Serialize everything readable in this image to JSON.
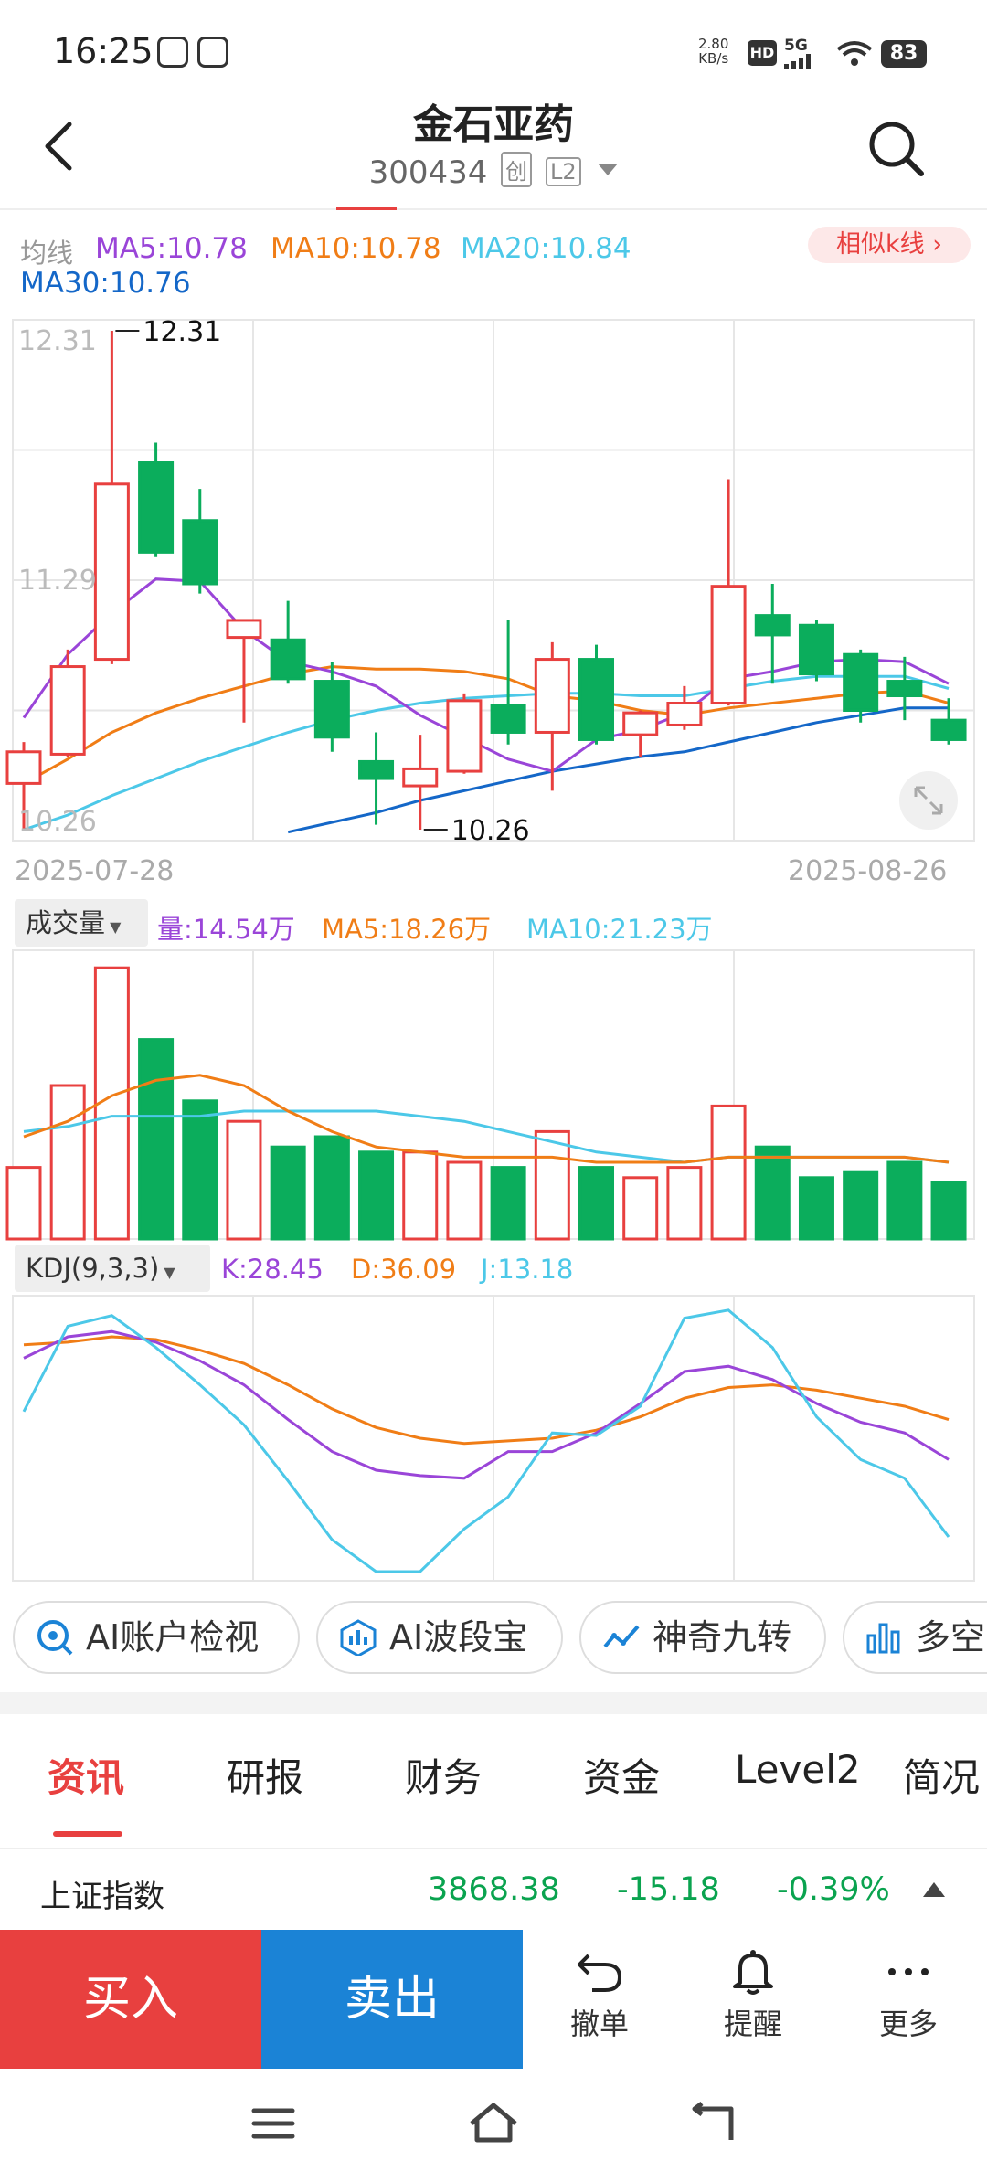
{
  "status_bar": {
    "time": "16:25",
    "net_speed_value": "2.80",
    "net_speed_unit": "KB/s",
    "hd": "HD",
    "network": "5G",
    "battery": "83"
  },
  "header": {
    "stock_name": "金石亚药",
    "stock_code": "300434",
    "tag_chuang": "创",
    "tag_level": "L2"
  },
  "ma_legend": {
    "label": "均线",
    "ma5": "MA5:10.78",
    "ma10": "MA10:10.78",
    "ma20": "MA20:10.84",
    "ma30": "MA30:10.76",
    "similar_button": "相似k线 ›"
  },
  "colors": {
    "up": "#e8403f",
    "down": "#0bad5c",
    "ma5": "#9a45d8",
    "ma10": "#f07d16",
    "ma20": "#4cc8e8",
    "ma30": "#1467c8",
    "index_green": "#0aa34f"
  },
  "price_axis": {
    "top_label": "12.31",
    "mid_label": "11.29",
    "bottom_label": "10.26",
    "high_marker": "12.31",
    "low_marker": "10.26",
    "start_date": "2025-07-28",
    "end_date": "2025-08-26"
  },
  "chart_data": {
    "type": "candlestick",
    "dates_shown": [
      "2025-07-28",
      "2025-08-26"
    ],
    "ylim": [
      10.26,
      12.31
    ],
    "candles": [
      {
        "open": 10.45,
        "close": 10.58,
        "high": 10.62,
        "low": 10.26
      },
      {
        "open": 10.57,
        "close": 10.93,
        "high": 11.0,
        "low": 10.56
      },
      {
        "open": 10.96,
        "close": 11.68,
        "high": 12.31,
        "low": 10.94
      },
      {
        "open": 11.77,
        "close": 11.4,
        "high": 11.85,
        "low": 11.38
      },
      {
        "open": 11.53,
        "close": 11.27,
        "high": 11.66,
        "low": 11.23
      },
      {
        "open": 11.05,
        "close": 11.12,
        "high": 11.12,
        "low": 10.7
      },
      {
        "open": 11.04,
        "close": 10.88,
        "high": 11.2,
        "low": 10.86
      },
      {
        "open": 10.87,
        "close": 10.64,
        "high": 10.95,
        "low": 10.58
      },
      {
        "open": 10.54,
        "close": 10.47,
        "high": 10.66,
        "low": 10.28
      },
      {
        "open": 10.44,
        "close": 10.51,
        "high": 10.65,
        "low": 10.26
      },
      {
        "open": 10.5,
        "close": 10.79,
        "high": 10.82,
        "low": 10.49
      },
      {
        "open": 10.77,
        "close": 10.66,
        "high": 11.12,
        "low": 10.61
      },
      {
        "open": 10.66,
        "close": 10.96,
        "high": 11.03,
        "low": 10.42
      },
      {
        "open": 10.96,
        "close": 10.63,
        "high": 11.02,
        "low": 10.61
      },
      {
        "open": 10.65,
        "close": 10.74,
        "high": 10.75,
        "low": 10.56
      },
      {
        "open": 10.69,
        "close": 10.78,
        "high": 10.85,
        "low": 10.67
      },
      {
        "open": 10.78,
        "close": 11.26,
        "high": 11.7,
        "low": 10.77
      },
      {
        "open": 11.14,
        "close": 11.06,
        "high": 11.27,
        "low": 10.86
      },
      {
        "open": 11.1,
        "close": 10.9,
        "high": 11.12,
        "low": 10.87
      },
      {
        "open": 10.98,
        "close": 10.75,
        "high": 11.0,
        "low": 10.7
      },
      {
        "open": 10.87,
        "close": 10.81,
        "high": 10.97,
        "low": 10.71
      },
      {
        "open": 10.71,
        "close": 10.63,
        "high": 10.8,
        "low": 10.61
      }
    ],
    "ma5": [
      10.72,
      10.98,
      11.15,
      11.29,
      11.28,
      11.08,
      10.95,
      10.91,
      10.85,
      10.73,
      10.64,
      10.55,
      10.5,
      10.63,
      10.67,
      10.74,
      10.88,
      10.91,
      10.95,
      10.96,
      10.95,
      10.86
    ],
    "ma10": [
      10.45,
      10.55,
      10.66,
      10.74,
      10.8,
      10.85,
      10.9,
      10.93,
      10.92,
      10.92,
      10.91,
      10.88,
      10.81,
      10.79,
      10.75,
      10.73,
      10.76,
      10.78,
      10.8,
      10.82,
      10.83,
      10.78
    ],
    "ma20": [
      10.26,
      10.32,
      10.4,
      10.47,
      10.54,
      10.6,
      10.66,
      10.71,
      10.75,
      10.78,
      10.8,
      10.81,
      10.82,
      10.82,
      10.81,
      10.81,
      10.84,
      10.87,
      10.89,
      10.89,
      10.89,
      10.84
    ],
    "ma30": [
      null,
      null,
      null,
      null,
      null,
      null,
      10.25,
      10.29,
      10.33,
      10.38,
      10.42,
      10.46,
      10.5,
      10.53,
      10.56,
      10.58,
      10.62,
      10.66,
      10.7,
      10.73,
      10.76,
      10.76
    ],
    "volume_unit": "万",
    "volumes": [
      14,
      30,
      53,
      39,
      27,
      23,
      18,
      20,
      17,
      17,
      15,
      14,
      21,
      14,
      12,
      14,
      26,
      18,
      12,
      13,
      15,
      11
    ],
    "volume_ma5": [
      20,
      23,
      28,
      31,
      32,
      30,
      25,
      21,
      18,
      17,
      16,
      16,
      16,
      15,
      15,
      15,
      16,
      16,
      16,
      16,
      16,
      15
    ],
    "volume_ma10": [
      21,
      22,
      24,
      24,
      24,
      25,
      25,
      25,
      25,
      24,
      23,
      21,
      19,
      17,
      16,
      15,
      16,
      16,
      16,
      16,
      16,
      15
    ],
    "kdj_k": [
      80,
      88,
      90,
      86,
      79,
      70,
      57,
      45,
      38,
      36,
      35,
      45,
      45,
      52,
      63,
      75,
      77,
      72,
      63,
      56,
      52,
      42
    ],
    "kdj_d": [
      85,
      86,
      88,
      87,
      83,
      78,
      70,
      61,
      54,
      50,
      48,
      49,
      50,
      53,
      58,
      65,
      69,
      70,
      68,
      65,
      62,
      57
    ],
    "kdj_j": [
      60,
      92,
      96,
      84,
      70,
      55,
      34,
      12,
      0,
      0,
      16,
      28,
      52,
      51,
      62,
      95,
      98,
      84,
      58,
      42,
      35,
      13
    ]
  },
  "volume_legend": {
    "selector": "成交量",
    "vol": "量:14.54万",
    "ma5": "MA5:18.26万",
    "ma10": "MA10:21.23万"
  },
  "kdj_legend": {
    "selector": "KDJ(9,3,3)",
    "k": "K:28.45",
    "d": "D:36.09",
    "j": "J:13.18"
  },
  "feature_pills": [
    {
      "label": "AI账户检视",
      "icon": "ai-eye-icon"
    },
    {
      "label": "AI波段宝",
      "icon": "ai-wave-icon"
    },
    {
      "label": "神奇九转",
      "icon": "trend-line-icon"
    },
    {
      "label": "多空",
      "icon": "bar-chart-icon"
    }
  ],
  "tabs": [
    "资讯",
    "研报",
    "财务",
    "资金",
    "Level2",
    "简况"
  ],
  "index_row": {
    "name": "上证指数",
    "value": "3868.38",
    "change": "-15.18",
    "pct": "-0.39%"
  },
  "actions": {
    "buy": "买入",
    "sell": "卖出",
    "cancel": "撤单",
    "alert": "提醒",
    "more": "更多"
  }
}
